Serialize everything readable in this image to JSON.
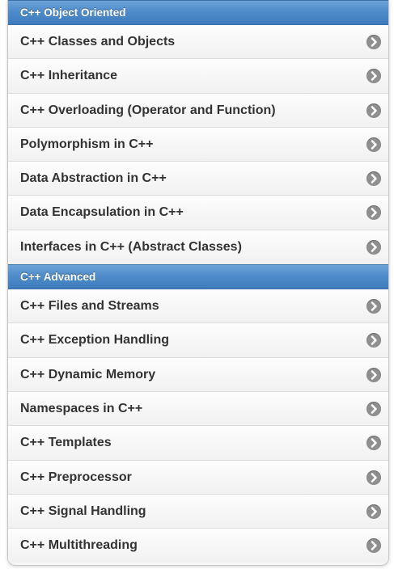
{
  "sections": [
    {
      "title": "C++ Object Oriented",
      "items": [
        {
          "label": "C++ Classes and Objects"
        },
        {
          "label": "C++ Inheritance"
        },
        {
          "label": "C++ Overloading (Operator and Function)"
        },
        {
          "label": "Polymorphism in C++"
        },
        {
          "label": "Data Abstraction in C++"
        },
        {
          "label": "Data Encapsulation in C++"
        },
        {
          "label": "Interfaces in C++ (Abstract Classes)"
        }
      ]
    },
    {
      "title": "C++ Advanced",
      "items": [
        {
          "label": "C++ Files and Streams"
        },
        {
          "label": "C++ Exception Handling"
        },
        {
          "label": "C++ Dynamic Memory"
        },
        {
          "label": "Namespaces in C++"
        },
        {
          "label": "C++ Templates"
        },
        {
          "label": "C++ Preprocessor"
        },
        {
          "label": "C++ Signal Handling"
        },
        {
          "label": "C++ Multithreading"
        }
      ]
    }
  ],
  "icons": {
    "item_arrow": "chevron-right-circle-icon"
  },
  "colors": {
    "header_blue": "#4f8ccb",
    "item_text": "#333333",
    "arrow_gray": "#8f8f8f"
  }
}
